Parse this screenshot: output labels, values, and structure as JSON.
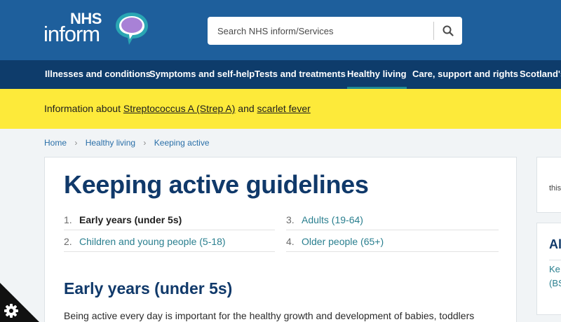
{
  "logo": {
    "nhs": "NHS",
    "inform": "inform"
  },
  "search": {
    "placeholder": "Search NHS inform/Services"
  },
  "nav": {
    "items": [
      {
        "label": "Illnesses and conditions"
      },
      {
        "label": "Symptoms and self-help"
      },
      {
        "label": "Tests and treatments"
      },
      {
        "label": "Healthy living"
      },
      {
        "label": "Care, support and rights"
      },
      {
        "label": "Scotland's"
      }
    ],
    "active": "Healthy living"
  },
  "alert": {
    "prefix": "Information about ",
    "link1": "Streptococcus A (Strep A)",
    "middle": " and ",
    "link2": "scarlet fever"
  },
  "breadcrumb": [
    "Home",
    "Healthy living",
    "Keeping active"
  ],
  "main": {
    "title": "Keeping active guidelines",
    "toc": [
      {
        "num": "1.",
        "label": "Early years (under 5s)"
      },
      {
        "num": "2.",
        "label": "Children and young people (5-18)"
      },
      {
        "num": "3.",
        "label": "Adults (19-64)"
      },
      {
        "num": "4.",
        "label": "Older people (65+)"
      }
    ],
    "section_title": "Early years (under 5s)",
    "body": "Being active every day is important for the healthy growth and development of babies, toddlers"
  },
  "sidebar": {
    "card1_text": "this",
    "card2_title": "Al",
    "card2_link1": "Ke",
    "card2_link2": "(BS"
  },
  "colors": {
    "header": "#1e5f9c",
    "nav": "#0e3c6b",
    "alert": "#fdea3a",
    "title": "#10396a",
    "link": "#2a7f8f",
    "bubble": "#a881d6",
    "bubble_ring": "#2aa6b3"
  },
  "icons": {
    "search": "search-icon",
    "cookie": "gear-icon",
    "logo": "speech-bubble-icon"
  }
}
